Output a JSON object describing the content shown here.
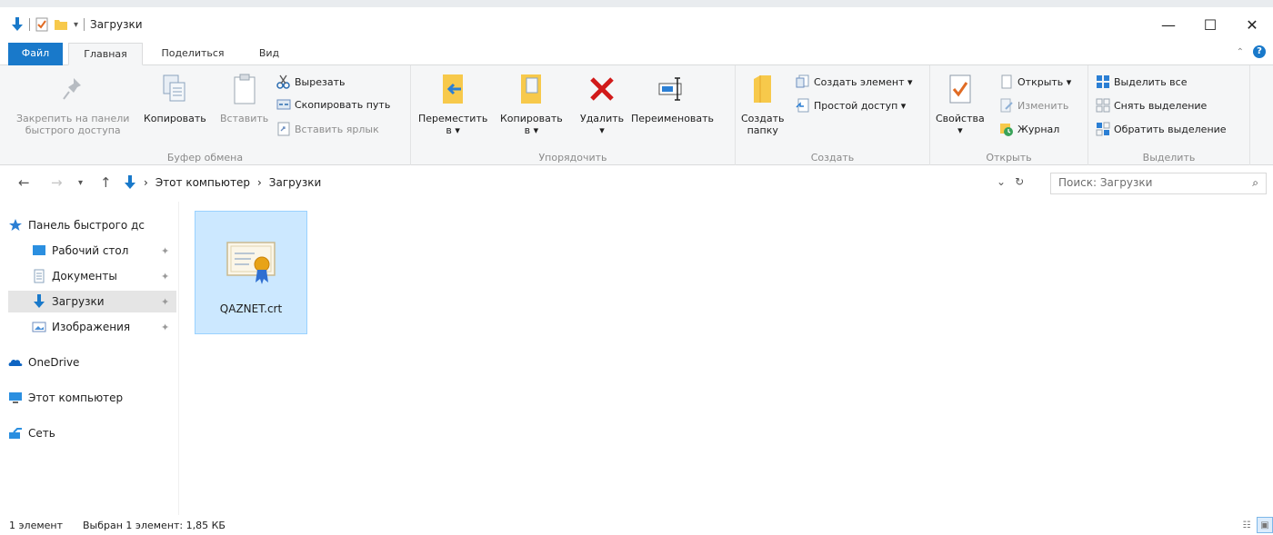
{
  "window": {
    "title": "Загрузки",
    "controls": {
      "minimize": "—",
      "maximize": "☐",
      "close": "✕"
    }
  },
  "ribbon_tabs": {
    "file": "Файл",
    "home": "Главная",
    "share": "Поделиться",
    "view": "Вид"
  },
  "ribbon": {
    "clipboard": {
      "label": "Буфер обмена",
      "pin_line1": "Закрепить на панели",
      "pin_line2": "быстрого доступа",
      "copy": "Копировать",
      "paste": "Вставить",
      "cut": "Вырезать",
      "copy_path": "Скопировать путь",
      "paste_shortcut": "Вставить ярлык"
    },
    "organize": {
      "label": "Упорядочить",
      "move_line1": "Переместить",
      "move_line2": "в ▾",
      "copyto_line1": "Копировать",
      "copyto_line2": "в ▾",
      "delete": "Удалить",
      "delete_arrow": "▾",
      "rename": "Переименовать"
    },
    "new": {
      "label": "Создать",
      "folder_line1": "Создать",
      "folder_line2": "папку",
      "new_item": "Создать элемент ▾",
      "easy_access": "Простой доступ ▾"
    },
    "open": {
      "label": "Открыть",
      "properties": "Свойства",
      "properties_arrow": "▾",
      "open": "Открыть ▾",
      "edit": "Изменить",
      "history": "Журнал"
    },
    "select": {
      "label": "Выделить",
      "select_all": "Выделить все",
      "select_none": "Снять выделение",
      "invert": "Обратить выделение"
    }
  },
  "address": {
    "crumbs": [
      "Этот компьютер",
      "Загрузки"
    ],
    "separator": "›",
    "search_placeholder": "Поиск: Загрузки"
  },
  "sidebar": {
    "items": [
      {
        "label": "Панель быстрого дс",
        "icon": "star-icon"
      },
      {
        "label": "Рабочий стол",
        "icon": "desktop-icon",
        "pinned": true
      },
      {
        "label": "Документы",
        "icon": "documents-icon",
        "pinned": true
      },
      {
        "label": "Загрузки",
        "icon": "downloads-icon",
        "pinned": true,
        "selected": true
      },
      {
        "label": "Изображения",
        "icon": "pictures-icon",
        "pinned": true
      },
      {
        "label": "OneDrive",
        "icon": "onedrive-icon"
      },
      {
        "label": "Этот компьютер",
        "icon": "computer-icon"
      },
      {
        "label": "Сеть",
        "icon": "network-icon"
      }
    ]
  },
  "files": [
    {
      "name": "QAZNET.crt",
      "icon": "certificate-icon",
      "selected": true
    }
  ],
  "status": {
    "count": "1 элемент",
    "selection": "Выбран 1 элемент: 1,85 КБ"
  },
  "colors": {
    "accent": "#1979ca",
    "selection_bg": "#cce8ff",
    "selection_border": "#99d1ff",
    "ribbon_bg": "#f5f6f7"
  }
}
